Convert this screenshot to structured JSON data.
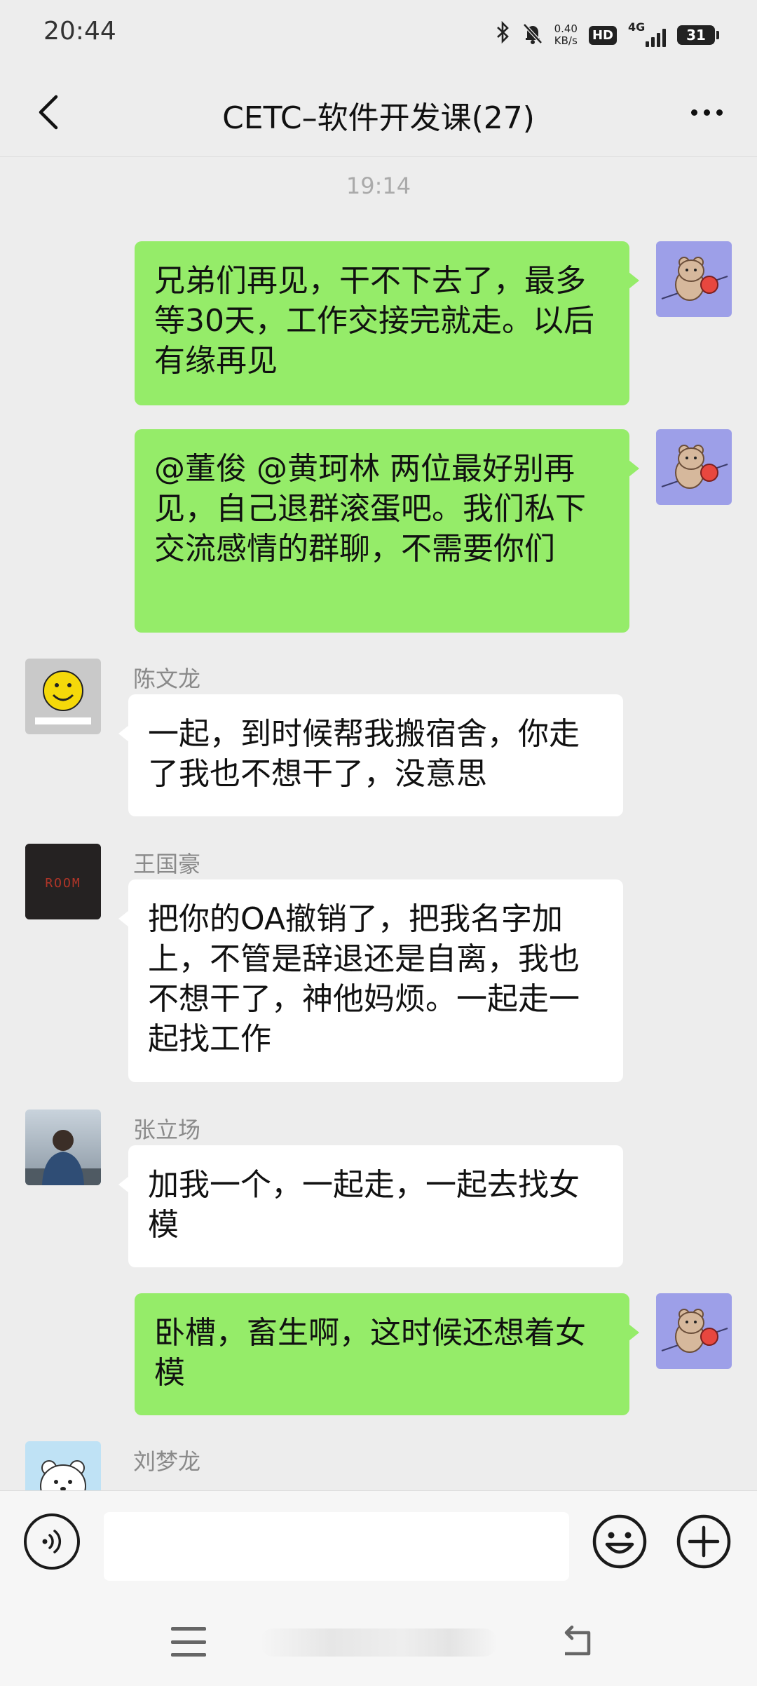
{
  "status_bar": {
    "time": "20:44",
    "net_speed_value": "0.40",
    "net_speed_unit": "KB/s",
    "hd_label": "HD",
    "network_label": "4G",
    "battery_level": "31",
    "icons": [
      "bluetooth-icon",
      "mute-bell-icon",
      "hd-icon",
      "signal-icon",
      "battery-icon"
    ]
  },
  "header": {
    "title": "CETC–软件开发课(27)",
    "back_icon": "chevron-left-icon",
    "more_icon": "more-horizontal-icon"
  },
  "chat": {
    "timestamp": "19:14",
    "messages": [
      {
        "from": "self",
        "text": "兄弟们再见，干不下去了，最多等30天，工作交接完就走。以后有缘再见",
        "avatar": "bear-avatar"
      },
      {
        "from": "self",
        "text": "@董俊 @黄珂林 两位最好别再见，自己退群滚蛋吧。我们私下交流感情的群聊，不需要你们",
        "avatar": "bear-avatar"
      },
      {
        "from": "other",
        "sender": "陈文龙",
        "text": "一起，到时候帮我搬宿舍，你走了我也不想干了，没意思",
        "avatar": "smiley-avatar"
      },
      {
        "from": "other",
        "sender": "王国豪",
        "text": "把你的OA撤销了，把我名字加上，不管是辞退还是自离，我也不想干了，神他妈烦。一起走一起找工作",
        "avatar": "room-avatar"
      },
      {
        "from": "other",
        "sender": "张立场",
        "text": "加我一个，一起走，一起去找女模",
        "avatar": "person-avatar"
      },
      {
        "from": "self",
        "text": "卧槽，畜生啊，这时候还想着女模",
        "avatar": "bear-avatar"
      },
      {
        "from": "other",
        "sender": "刘梦龙",
        "text": "",
        "avatar": "polar-bear-avatar"
      }
    ]
  },
  "input_bar": {
    "voice_icon": "voice-icon",
    "text_value": "",
    "emoji_icon": "emoji-icon",
    "plus_icon": "plus-icon"
  },
  "nav_bar": {
    "icons": [
      "menu-icon",
      "home-pill",
      "back-arrow-icon"
    ]
  },
  "colors": {
    "self_bubble": "#95ec69",
    "other_bubble": "#ffffff",
    "background": "#ededed"
  }
}
